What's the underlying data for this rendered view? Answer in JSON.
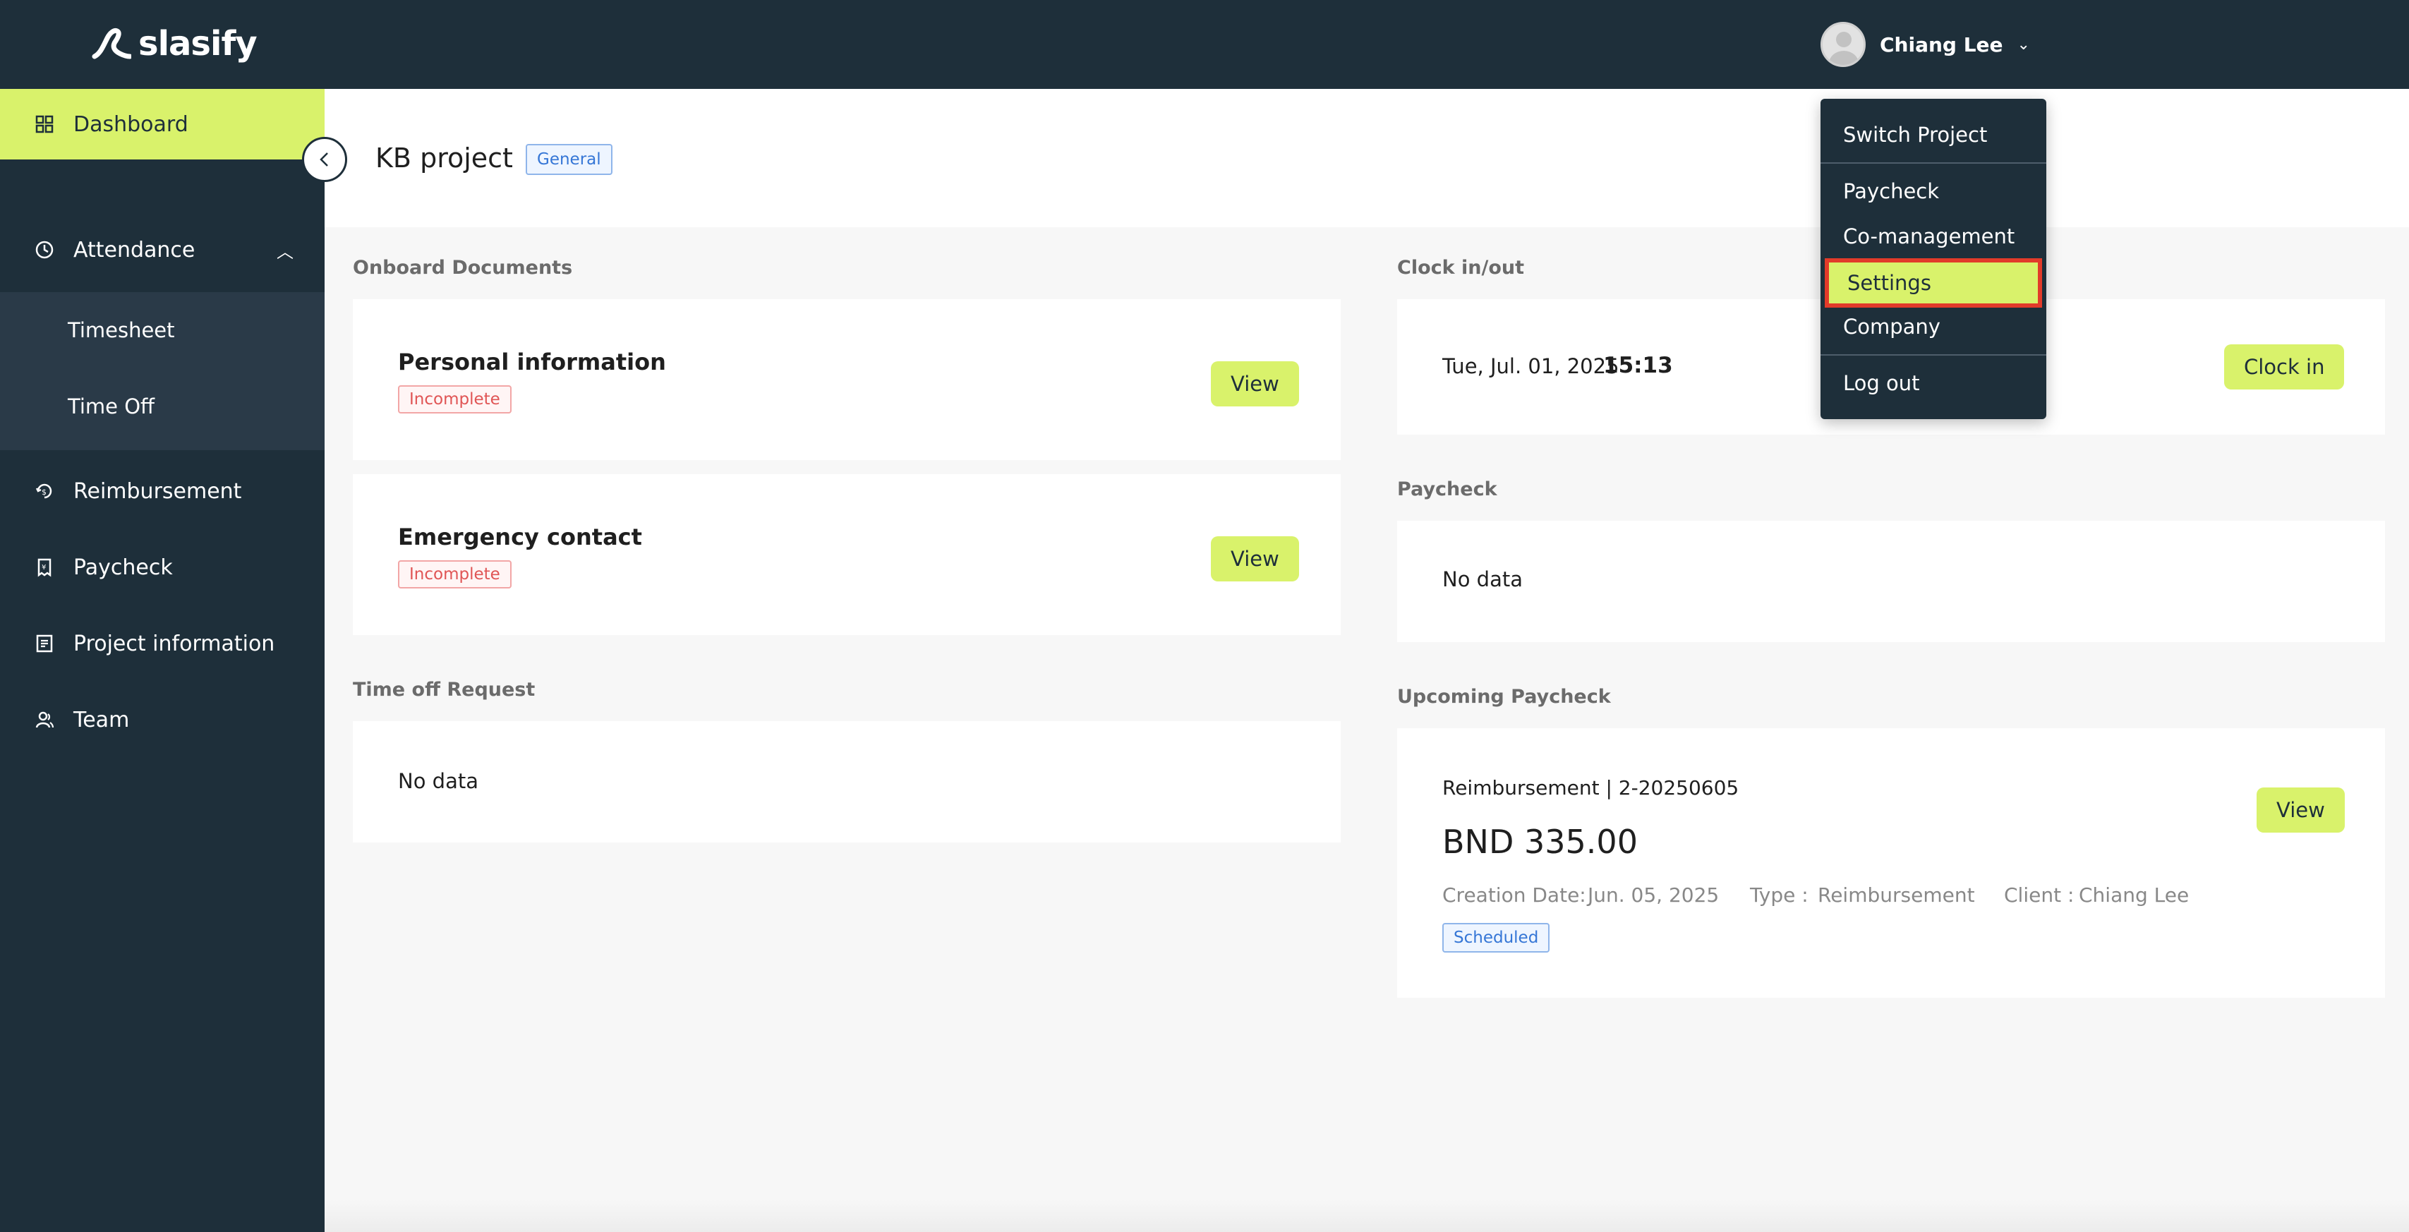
{
  "brand": {
    "name": "slasify"
  },
  "user": {
    "name": "Chiang Lee"
  },
  "sidebar": {
    "items": [
      {
        "label": "Dashboard"
      },
      {
        "label": "Attendance"
      },
      {
        "label": "Timesheet"
      },
      {
        "label": "Time Off"
      },
      {
        "label": "Reimbursement"
      },
      {
        "label": "Paycheck"
      },
      {
        "label": "Project information"
      },
      {
        "label": "Team"
      }
    ]
  },
  "header": {
    "title": "KB project",
    "tag": "General"
  },
  "onboard": {
    "section_title": "Onboard Documents",
    "cards": [
      {
        "title": "Personal information",
        "status": "Incomplete",
        "action": "View"
      },
      {
        "title": "Emergency contact",
        "status": "Incomplete",
        "action": "View"
      }
    ]
  },
  "timeoff": {
    "section_title": "Time off Request",
    "empty": "No data"
  },
  "clock": {
    "section_title": "Clock in/out",
    "date": "Tue, Jul. 01, 2025",
    "time": "15:13",
    "action": "Clock in"
  },
  "paycheck": {
    "section_title": "Paycheck",
    "empty": "No data"
  },
  "upcoming": {
    "section_title": "Upcoming Paycheck",
    "ref": "Reimbursement | 2-20250605",
    "amount": "BND 335.00",
    "creation_label": "Creation Date:",
    "creation_value": "Jun. 05, 2025",
    "type_label": "Type :",
    "type_value": "Reimbursement",
    "client_label": "Client :",
    "client_value": "Chiang Lee",
    "status": "Scheduled",
    "action": "View"
  },
  "dropdown": {
    "items": [
      {
        "label": "Switch Project"
      },
      {
        "label": "Paycheck"
      },
      {
        "label": "Co-management"
      },
      {
        "label": "Settings"
      },
      {
        "label": "Company"
      },
      {
        "label": "Log out"
      }
    ]
  },
  "colors": {
    "dark": "#1e2f3a",
    "accent": "#d9f26b",
    "highlight_border": "#e23b2a"
  }
}
